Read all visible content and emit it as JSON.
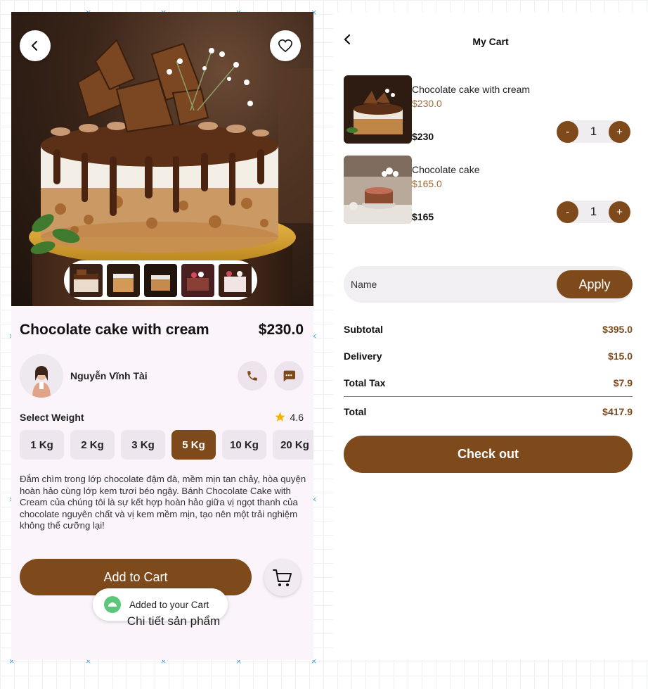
{
  "detail": {
    "product": {
      "title": "Chocolate cake with cream",
      "price": "$230.0"
    },
    "seller": {
      "name": "Nguyễn Vĩnh Tài"
    },
    "weight": {
      "label": "Select  Weight",
      "rating": "4.6",
      "options": [
        "1 Kg",
        "2 Kg",
        "3 Kg",
        "5 Kg",
        "10 Kg",
        "20 Kg"
      ],
      "selected": "5 Kg"
    },
    "description": "Đắm chìm trong lớp chocolate đậm đà, mềm mịn tan chảy, hòa quyện hoàn hảo cùng lớp kem tươi béo ngậy. Bánh Chocolate Cake with Cream của chúng tôi là sự kết hợp hoàn hảo giữa vị ngọt thanh của chocolate nguyên chất và vị kem mềm mịn, tạo nên một trải nghiệm không thể cưỡng lại!",
    "add_to_cart_label": "Add to Cart",
    "toast_text": "Added to your Cart",
    "caption": "Chi tiết sản phẩm"
  },
  "cart": {
    "title": "My Cart",
    "items": [
      {
        "name": "Chocolate cake with cream",
        "price": "$230.0",
        "total": "$230",
        "qty": "1"
      },
      {
        "name": "Chocolate cake",
        "price": "$165.0",
        "total": "$165",
        "qty": "1"
      }
    ],
    "promo": {
      "placeholder": "Name",
      "apply_label": "Apply"
    },
    "summary": {
      "subtotal_label": "Subtotal",
      "subtotal": "$395.0",
      "delivery_label": "Delivery",
      "delivery": "$15.0",
      "tax_label": "Total Tax",
      "tax": "$7.9",
      "total_label": "Total",
      "total": "$417.9"
    },
    "checkout_label": "Check out"
  },
  "colors": {
    "accent": "#7e4a1c",
    "price_text": "#a06c35",
    "detail_bg": "#fbf4fb"
  },
  "icons": [
    "back-arrow-icon",
    "heart-icon",
    "phone-icon",
    "chat-icon",
    "star-icon",
    "cart-icon",
    "check-icon",
    "minus-icon",
    "plus-icon"
  ]
}
